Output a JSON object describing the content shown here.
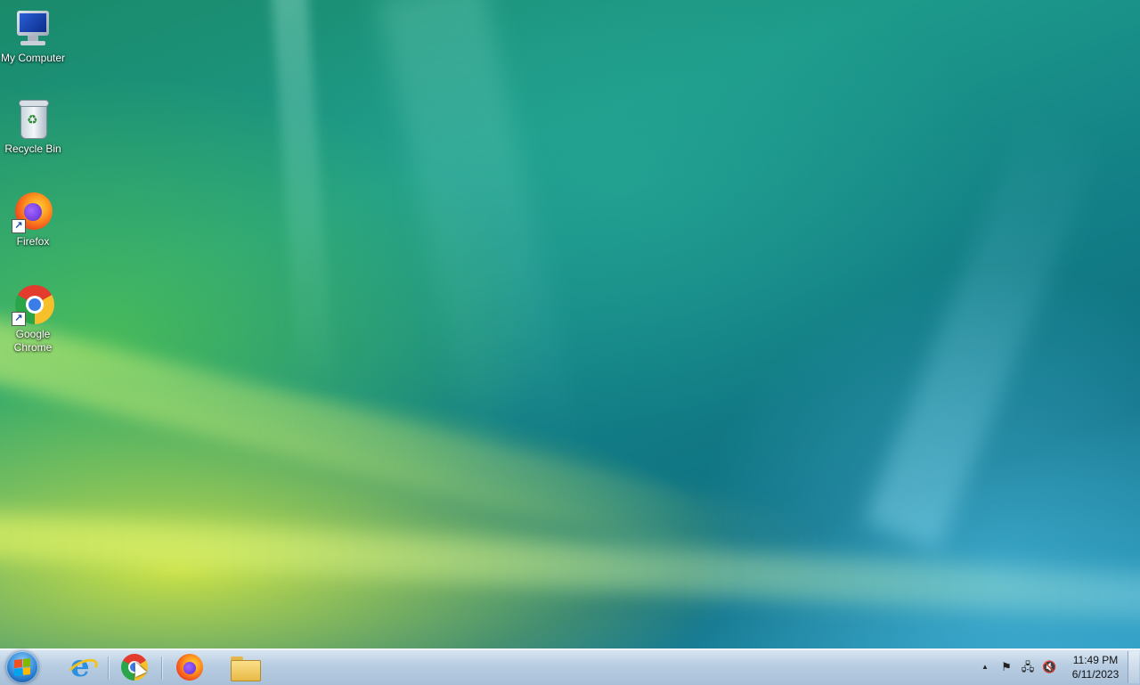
{
  "desktop": {
    "icons": [
      {
        "label": "My Computer",
        "icon": "computer-icon"
      },
      {
        "label": "Recycle Bin",
        "icon": "recycle-bin-icon"
      },
      {
        "label": "Firefox",
        "icon": "firefox-icon",
        "shortcut": true
      },
      {
        "label": "Google Chrome",
        "icon": "chrome-icon",
        "shortcut": true
      }
    ],
    "shortcut_arrow": "↗"
  },
  "taskbar": {
    "start_button": {
      "icon": "windows-start-icon"
    },
    "pinned": [
      {
        "name": "Internet Explorer",
        "icon": "internet-explorer-icon"
      },
      {
        "name": "Google Chrome",
        "icon": "chrome-icon"
      },
      {
        "name": "Firefox",
        "icon": "firefox-icon"
      },
      {
        "name": "Windows Explorer",
        "icon": "folder-icon"
      }
    ],
    "tray": {
      "overflow_arrow": "▲",
      "action_center": "⚑",
      "network": "🖧",
      "volume": "🔇",
      "time": "11:49 PM",
      "date": "6/11/2023"
    }
  },
  "colors": {
    "start_orb": "#2a7fd0",
    "windows_flag": [
      "#f25022",
      "#7fba00",
      "#00a4ef",
      "#ffb900"
    ]
  }
}
